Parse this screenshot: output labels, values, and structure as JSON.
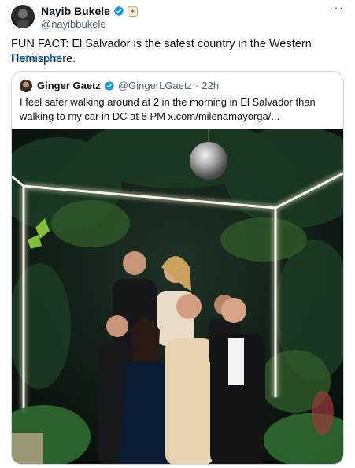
{
  "author": {
    "display_name": "Nayib Bukele",
    "handle": "@nayibbukele",
    "avatar_icon": "profile-photo",
    "verified_icon": "verified-badge-icon",
    "affiliate_icon": "affiliate-badge-icon"
  },
  "post": {
    "text": "FUN FACT: El Salvador is the safest country in the Western Hemisphere.",
    "translate_label": "Traducir post",
    "more_label": "···"
  },
  "quoted_post": {
    "display_name": "Ginger Gaetz",
    "handle": "@GingerLGaetz",
    "separator": "·",
    "time": "22h",
    "text": "I feel safer walking around at 2 in the morning in El Salvador than walking to my car in DC at 8 PM  x.com/milenamayorga/...",
    "media_description_icon": "group-photo"
  },
  "colors": {
    "link": "#1d9bf0",
    "verified": "#1d9bf0",
    "border": "#cfd9de",
    "secondary_text": "#536471"
  }
}
